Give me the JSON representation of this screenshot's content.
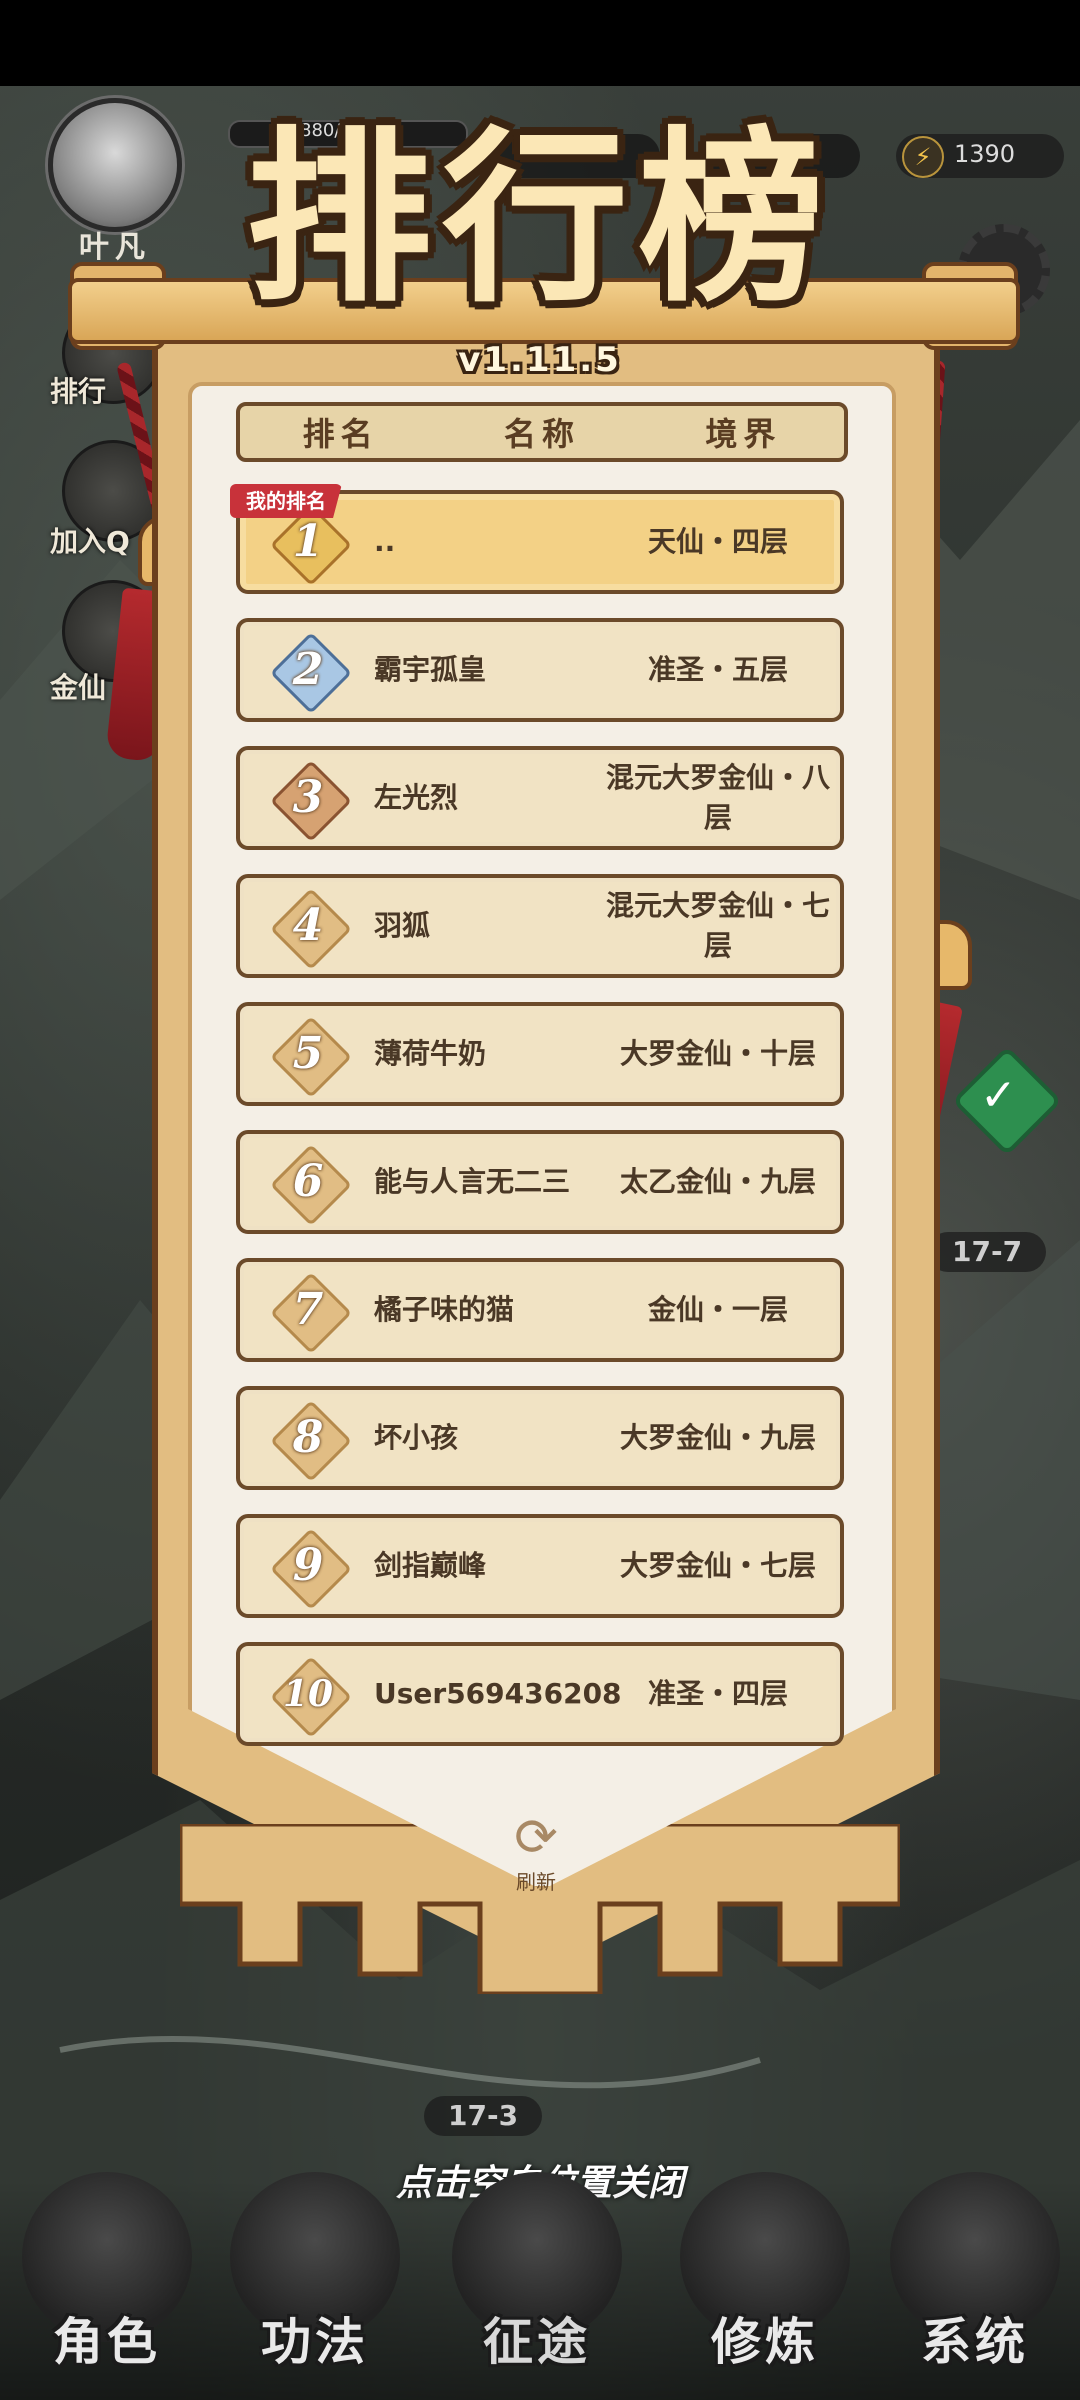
{
  "hud": {
    "player_name": "叶凡",
    "exp_text": "880/",
    "energy_value": "1390",
    "energy_icon": "lightning-icon"
  },
  "side_menu": [
    {
      "label": "排行",
      "icon": "ranking-icon"
    },
    {
      "label": "加入Q",
      "icon": "penguin-icon"
    },
    {
      "label": "金仙",
      "icon": "gift-icon"
    }
  ],
  "leaderboard": {
    "title": "排行榜",
    "version": "v1.11.5",
    "columns": [
      "排名",
      "名称",
      "境界"
    ],
    "my_rank_tag": "我的排名",
    "rows": [
      {
        "rank": "1",
        "name": "..",
        "realm": "天仙・四层"
      },
      {
        "rank": "2",
        "name": "霸宇孤皇",
        "realm": "准圣・五层"
      },
      {
        "rank": "3",
        "name": "左光烈",
        "realm": "混元大罗金仙・八层"
      },
      {
        "rank": "4",
        "name": "羽狐",
        "realm": "混元大罗金仙・七层"
      },
      {
        "rank": "5",
        "name": "薄荷牛奶",
        "realm": "大罗金仙・十层"
      },
      {
        "rank": "6",
        "name": "能与人言无二三",
        "realm": "太乙金仙・九层"
      },
      {
        "rank": "7",
        "name": "橘子味的猫",
        "realm": "金仙・一层"
      },
      {
        "rank": "8",
        "name": "坏小孩",
        "realm": "大罗金仙・九层"
      },
      {
        "rank": "9",
        "name": "剑指巅峰",
        "realm": "大罗金仙・七层"
      },
      {
        "rank": "10",
        "name": "User569436208",
        "realm": "准圣・四层"
      }
    ],
    "refresh_label": "刷新"
  },
  "map": {
    "stage_current": "17-7",
    "stage_prev": "17-3"
  },
  "close_hint": "点击空白位置关闭",
  "bottom_nav": [
    {
      "label": "角色",
      "icon": "character-icon"
    },
    {
      "label": "功法",
      "icon": "book-icon"
    },
    {
      "label": "征途",
      "icon": "sword-icon"
    },
    {
      "label": "修炼",
      "icon": "meditation-icon"
    },
    {
      "label": "系统",
      "icon": "system-icon"
    }
  ],
  "colors": {
    "banner": "#e2bd81",
    "panel": "#f4efe6",
    "highlight_row": "#f3d186",
    "tag_red": "#c8323a"
  }
}
